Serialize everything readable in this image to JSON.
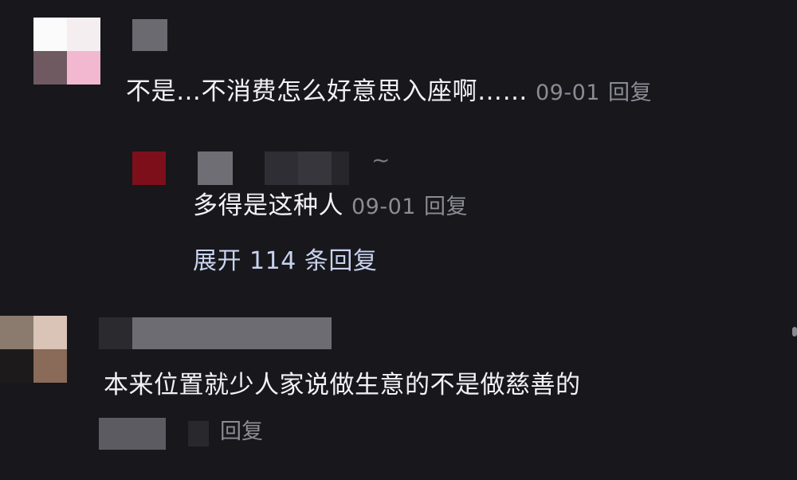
{
  "comments": [
    {
      "text": "不是…不消费怎么好意思入座啊……",
      "date": "09-01",
      "reply_label": "回复",
      "replies": [
        {
          "text": "多得是这种人",
          "date": "09-01",
          "reply_label": "回复",
          "name_suffix": "~"
        }
      ],
      "expand_label": "展开 114 条回复"
    },
    {
      "text": "本来位置就少人家说做生意的不是做慈善的",
      "reply_label": "回复"
    }
  ],
  "colors": {
    "background": "#17171c",
    "primary_text": "#f2f2f4",
    "meta_text": "#8c8c95",
    "link_text": "#c9d3ee"
  }
}
